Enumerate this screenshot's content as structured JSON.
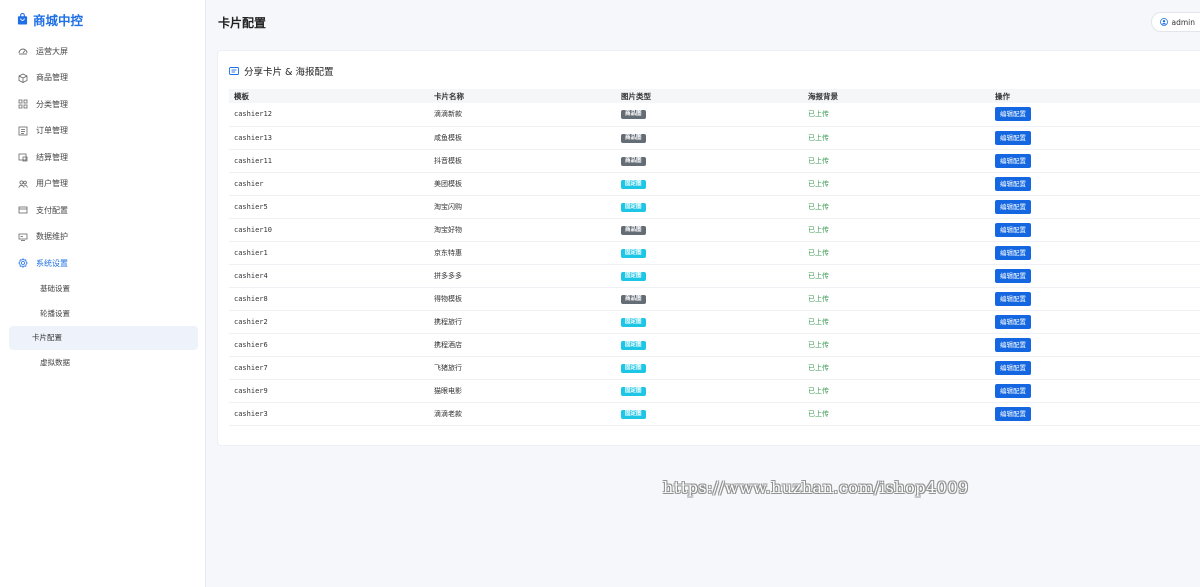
{
  "brand": {
    "name": "商城中控"
  },
  "sidebar": {
    "items": [
      {
        "label": "运营大屏",
        "icon": "dashboard-icon"
      },
      {
        "label": "商品管理",
        "icon": "box-icon"
      },
      {
        "label": "分类管理",
        "icon": "grid-icon"
      },
      {
        "label": "订单管理",
        "icon": "list-icon"
      },
      {
        "label": "结算管理",
        "icon": "settlement-icon"
      },
      {
        "label": "用户管理",
        "icon": "users-icon"
      },
      {
        "label": "支付配置",
        "icon": "card-icon"
      },
      {
        "label": "数据维护",
        "icon": "data-icon"
      },
      {
        "label": "系统设置",
        "icon": "gear-icon"
      }
    ],
    "sub_items": [
      {
        "label": "基础设置"
      },
      {
        "label": "轮播设置"
      },
      {
        "label": "卡片配置"
      },
      {
        "label": "虚拟数据"
      }
    ]
  },
  "header": {
    "title": "卡片配置",
    "user": "admin"
  },
  "card": {
    "title": "分享卡片 & 海报配置",
    "columns": [
      "模板",
      "卡片名称",
      "图片类型",
      "海报背景",
      "操作"
    ],
    "rows": [
      {
        "template": "cashier12",
        "name": "滴滴新款",
        "type": "商品图",
        "type_style": "gray",
        "bg": "已上传",
        "action": "编辑配置"
      },
      {
        "template": "cashier13",
        "name": "咸鱼模板",
        "type": "商品图",
        "type_style": "gray",
        "bg": "已上传",
        "action": "编辑配置"
      },
      {
        "template": "cashier11",
        "name": "抖音模板",
        "type": "商品图",
        "type_style": "gray",
        "bg": "已上传",
        "action": "编辑配置"
      },
      {
        "template": "cashier",
        "name": "美团模板",
        "type": "固定图",
        "type_style": "cyan",
        "bg": "已上传",
        "action": "编辑配置"
      },
      {
        "template": "cashier5",
        "name": "淘宝闪购",
        "type": "固定图",
        "type_style": "cyan",
        "bg": "已上传",
        "action": "编辑配置"
      },
      {
        "template": "cashier10",
        "name": "淘宝好物",
        "type": "商品图",
        "type_style": "gray",
        "bg": "已上传",
        "action": "编辑配置"
      },
      {
        "template": "cashier1",
        "name": "京东特惠",
        "type": "固定图",
        "type_style": "cyan",
        "bg": "已上传",
        "action": "编辑配置"
      },
      {
        "template": "cashier4",
        "name": "拼多多多",
        "type": "固定图",
        "type_style": "cyan",
        "bg": "已上传",
        "action": "编辑配置"
      },
      {
        "template": "cashier8",
        "name": "得物模板",
        "type": "商品图",
        "type_style": "gray",
        "bg": "已上传",
        "action": "编辑配置"
      },
      {
        "template": "cashier2",
        "name": "携程旅行",
        "type": "固定图",
        "type_style": "cyan",
        "bg": "已上传",
        "action": "编辑配置"
      },
      {
        "template": "cashier6",
        "name": "携程酒店",
        "type": "固定图",
        "type_style": "cyan",
        "bg": "已上传",
        "action": "编辑配置"
      },
      {
        "template": "cashier7",
        "name": "飞猪旅行",
        "type": "固定图",
        "type_style": "cyan",
        "bg": "已上传",
        "action": "编辑配置"
      },
      {
        "template": "cashier9",
        "name": "猫眼电影",
        "type": "固定图",
        "type_style": "cyan",
        "bg": "已上传",
        "action": "编辑配置"
      },
      {
        "template": "cashier3",
        "name": "滴滴老款",
        "type": "固定图",
        "type_style": "cyan",
        "bg": "已上传",
        "action": "编辑配置"
      }
    ]
  },
  "watermark": "https://www.huzhan.com/ishop4009",
  "colors": {
    "accent": "#1f6fe5",
    "button": "#1467e0",
    "tag_gray": "#646c75",
    "tag_cyan": "#1ec6e6",
    "status_green": "#3a9a52"
  }
}
